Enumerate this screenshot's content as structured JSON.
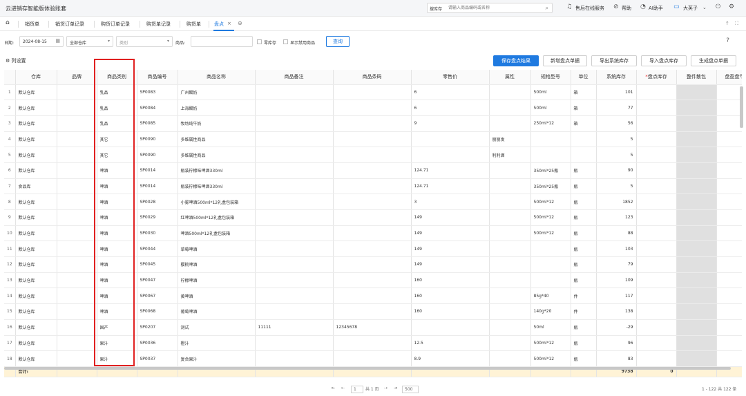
{
  "app": {
    "title": "云进销存智能版体验账套"
  },
  "search": {
    "prefix": "搜库存",
    "placeholder": "请输入商品编码或名称"
  },
  "header_links": {
    "service": "售后在线服务",
    "help": "帮助",
    "ai": "AI助手",
    "user": "大芙子"
  },
  "icons": {
    "home": "home-icon",
    "search": "search-icon",
    "headset": "headset-icon",
    "help": "help-circle-icon",
    "ai": "ai-icon",
    "avatar": "avatar-icon",
    "power": "power-icon",
    "settings": "settings-icon",
    "add_tab": "add-tab-icon",
    "calendar": "calendar-icon"
  },
  "tabs": [
    {
      "label": "销货单"
    },
    {
      "label": "销货订单记录"
    },
    {
      "label": "购货订单记录"
    },
    {
      "label": "购货单记录"
    },
    {
      "label": "购货单"
    },
    {
      "label": "盘点"
    }
  ],
  "tab_close": "×",
  "filters": {
    "date_label": "日期:",
    "date_value": "2024-08-15",
    "warehouse": "全部仓库",
    "category_placeholder": "类别",
    "product_label": "商品:",
    "zero_stock": "零库存",
    "show_disabled": "显示禁用商品",
    "query": "查询"
  },
  "actions": {
    "column_settings": "列设置",
    "save_result": "保存盘点结果",
    "new_sheet": "新增盘点单据",
    "export_system": "导出系统库存",
    "import_stock": "导入盘点库存",
    "generate_sheet": "生成盘点单据"
  },
  "table": {
    "headers": [
      "仓库",
      "品牌",
      "商品类别",
      "商品编号",
      "商品名称",
      "商品备注",
      "商品条码",
      "零售价",
      "属性",
      "规格型号",
      "单位",
      "系统库存",
      "盘点库存",
      "整件散包",
      "盘盈盘亏"
    ],
    "rows": [
      [
        "1",
        "默认仓库",
        "",
        "乳品",
        "SP0083",
        "广州酸奶",
        "",
        "",
        "6",
        "",
        "500ml",
        "箱",
        "101",
        "",
        ""
      ],
      [
        "2",
        "默认仓库",
        "",
        "乳品",
        "SP0084",
        "上海酸奶",
        "",
        "",
        "6",
        "",
        "500ml",
        "箱",
        "77",
        "",
        ""
      ],
      [
        "3",
        "默认仓库",
        "",
        "乳品",
        "SP0085",
        "牧场纯牛奶",
        "",
        "",
        "9",
        "",
        "250ml*12",
        "箱",
        "56",
        "",
        ""
      ],
      [
        "4",
        "默认仓库",
        "",
        "其它",
        "SP0090",
        "多维属性商品",
        "",
        "",
        "",
        "丽丽发",
        "",
        "",
        "5",
        "",
        ""
      ],
      [
        "5",
        "默认仓库",
        "",
        "其它",
        "SP0090",
        "多维属性商品",
        "",
        "",
        "",
        "利利酒",
        "",
        "",
        "5",
        "",
        ""
      ],
      [
        "6",
        "默认仓库",
        "",
        "啤酒",
        "SP0014",
        "瓶装柠檬味啤酒330ml",
        "",
        "",
        "124.71",
        "",
        "350ml*25瓶",
        "瓶",
        "90",
        "",
        ""
      ],
      [
        "7",
        "食品库",
        "",
        "啤酒",
        "SP0014",
        "瓶装柠檬味啤酒330ml",
        "",
        "",
        "124.71",
        "",
        "350ml*25瓶",
        "瓶",
        "5",
        "",
        ""
      ],
      [
        "8",
        "默认仓库",
        "",
        "啤酒",
        "SP0028",
        "小雾啤酒500ml*12礼盒包装箱",
        "",
        "",
        "3",
        "",
        "500ml*12",
        "瓶",
        "1852",
        "",
        ""
      ],
      [
        "9",
        "默认仓库",
        "",
        "啤酒",
        "SP0029",
        "红啤酒500ml*12礼盒包装箱",
        "",
        "",
        "149",
        "",
        "500ml*12",
        "瓶",
        "123",
        "",
        ""
      ],
      [
        "10",
        "默认仓库",
        "",
        "啤酒",
        "SP0030",
        "啤酒500ml*12礼盒包装箱",
        "",
        "",
        "149",
        "",
        "500ml*12",
        "瓶",
        "88",
        "",
        ""
      ],
      [
        "11",
        "默认仓库",
        "",
        "啤酒",
        "SP0044",
        "草莓啤酒",
        "",
        "",
        "149",
        "",
        "",
        "瓶",
        "103",
        "",
        ""
      ],
      [
        "12",
        "默认仓库",
        "",
        "啤酒",
        "SP0045",
        "樱桃啤酒",
        "",
        "",
        "149",
        "",
        "",
        "瓶",
        "79",
        "",
        ""
      ],
      [
        "13",
        "默认仓库",
        "",
        "啤酒",
        "SP0047",
        "柠檬啤酒",
        "",
        "",
        "160",
        "",
        "",
        "瓶",
        "109",
        "",
        ""
      ],
      [
        "14",
        "默认仓库",
        "",
        "啤酒",
        "SP0067",
        "黄啤酒",
        "",
        "",
        "160",
        "",
        "85g*40",
        "件",
        "117",
        "",
        ""
      ],
      [
        "15",
        "默认仓库",
        "",
        "啤酒",
        "SP0068",
        "葡萄啤酒",
        "",
        "",
        "160",
        "",
        "140g*20",
        "件",
        "138",
        "",
        ""
      ],
      [
        "16",
        "默认仓库",
        "",
        "国产",
        "SP0207",
        "测试",
        "11111",
        "12345678",
        "",
        "",
        "50ml",
        "瓶",
        "-29",
        "",
        ""
      ],
      [
        "17",
        "默认仓库",
        "",
        "果汁",
        "SP0036",
        "橙汁",
        "",
        "",
        "12.5",
        "",
        "500ml*12",
        "瓶",
        "96",
        "",
        ""
      ],
      [
        "18",
        "默认仓库",
        "",
        "果汁",
        "SP0037",
        "复合果汁",
        "",
        "",
        "8.9",
        "",
        "500ml*12",
        "瓶",
        "83",
        "",
        ""
      ]
    ],
    "sum_label": "合计:",
    "sum_system_stock": "9738",
    "sum_count_stock": "0"
  },
  "pager": {
    "page_input": "1",
    "page_total": "共 1 页",
    "page_size": "500",
    "summary": "1 - 122  共 122 条"
  }
}
